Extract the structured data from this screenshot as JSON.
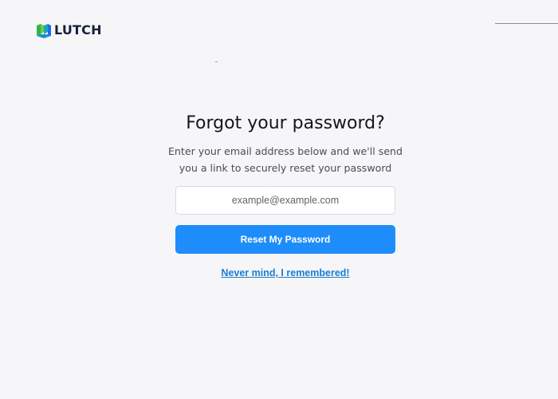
{
  "brand": {
    "name": "LUTCH",
    "logo_icon": "lutch-logo-icon",
    "colors": {
      "logo_green": "#3bbf3a",
      "logo_blue": "#1c6fe0",
      "logo_dark": "#17203a"
    }
  },
  "form": {
    "title": "Forgot your password?",
    "subtitle_line1": "Enter your email address below and we'll send",
    "subtitle_line2": "you a link to securely reset your password",
    "email_placeholder": "example@example.com",
    "email_value": "",
    "submit_label": "Reset My Password",
    "cancel_link": "Never mind, I remembered!"
  },
  "colors": {
    "background": "#f6f6f9",
    "accent": "#1e8cfb",
    "link": "#1a7dd1"
  }
}
